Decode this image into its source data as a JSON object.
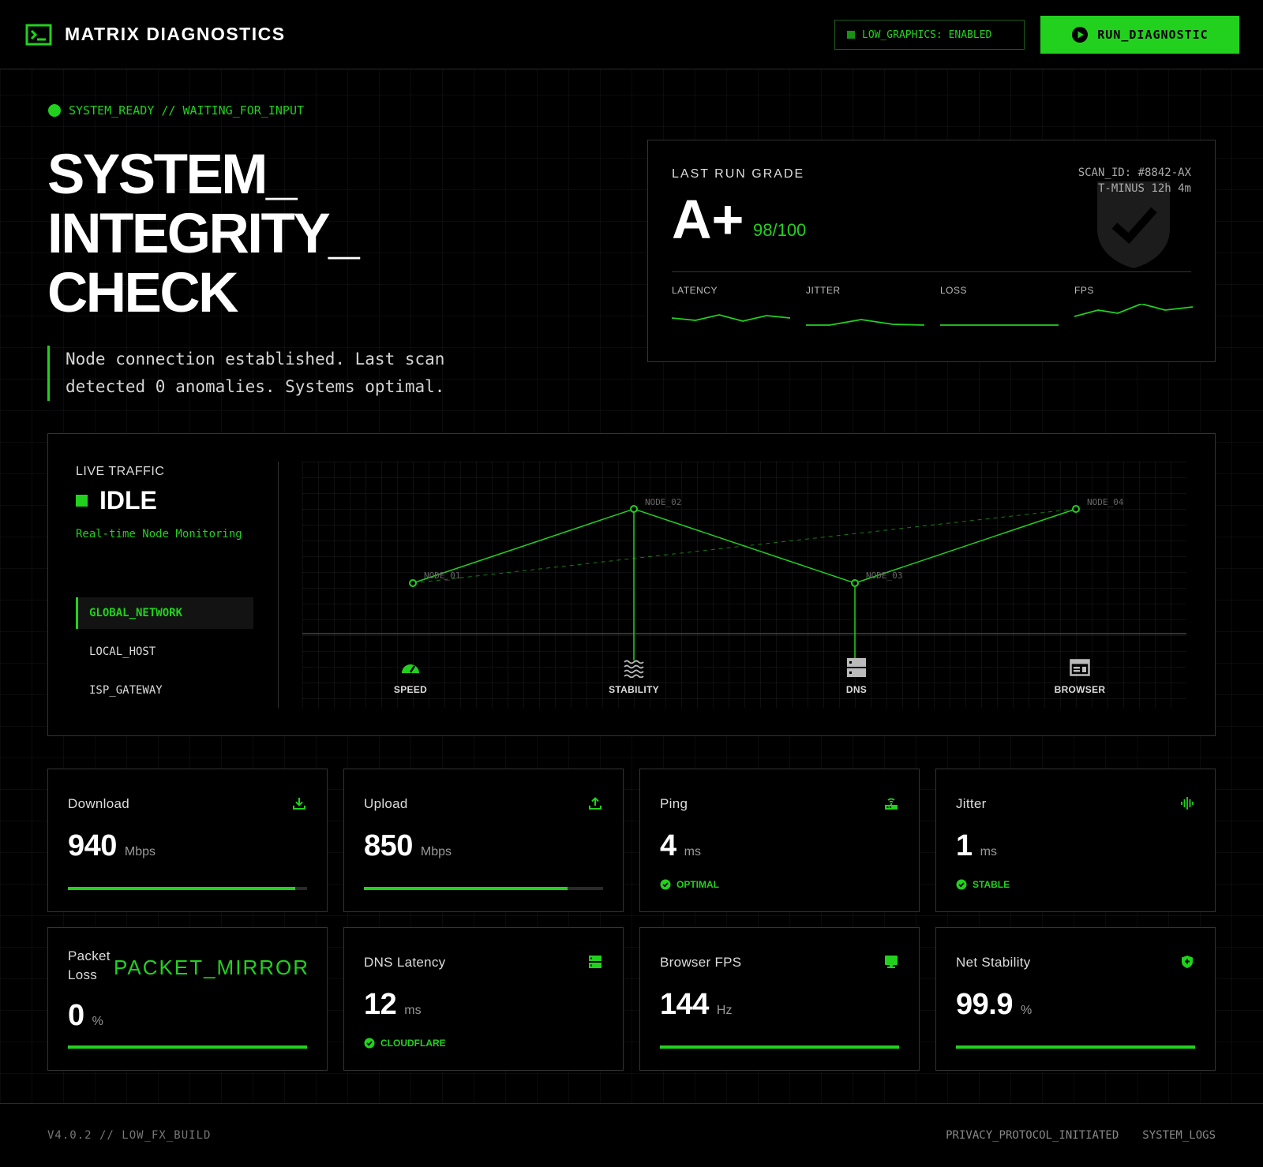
{
  "header": {
    "brand": "MATRIX DIAGNOSTICS",
    "low_graphics_label": "LOW_GRAPHICS: ENABLED",
    "run_button_label": "RUN_DIAGNOSTIC"
  },
  "hero": {
    "status": "SYSTEM_READY // WAITING_FOR_INPUT",
    "title_lines": [
      "SYSTEM_",
      "INTEGRITY_",
      "CHECK"
    ],
    "description": "Node connection established. Last scan detected 0 anomalies. Systems optimal."
  },
  "grade": {
    "label": "LAST RUN GRADE",
    "value": "A+",
    "score": "98/100",
    "scan_id": "SCAN_ID: #8842-AX",
    "t_minus": "T-MINUS 12h 4m",
    "metrics": [
      {
        "label": "LATENCY"
      },
      {
        "label": "JITTER"
      },
      {
        "label": "LOSS"
      },
      {
        "label": "FPS"
      }
    ]
  },
  "traffic": {
    "label": "LIVE TRAFFIC",
    "state": "IDLE",
    "subtitle": "Real-time Node Monitoring",
    "options": [
      {
        "label": "GLOBAL_NETWORK",
        "active": true
      },
      {
        "label": "LOCAL_HOST",
        "active": false
      },
      {
        "label": "ISP_GATEWAY",
        "active": false
      }
    ],
    "nodes": [
      "NODE_01",
      "NODE_02",
      "NODE_03",
      "NODE_04"
    ],
    "categories": [
      {
        "label": "SPEED",
        "icon": "speedometer-icon"
      },
      {
        "label": "STABILITY",
        "icon": "waves-icon"
      },
      {
        "label": "DNS",
        "icon": "server-icon"
      },
      {
        "label": "BROWSER",
        "icon": "browser-window-icon"
      }
    ]
  },
  "cards": [
    {
      "title": "Download",
      "value": "940",
      "unit": "Mbps",
      "progress": 0.95,
      "icon": "download-icon"
    },
    {
      "title": "Upload",
      "value": "850",
      "unit": "Mbps",
      "progress": 0.85,
      "icon": "upload-icon"
    },
    {
      "title": "Ping",
      "value": "4",
      "unit": "ms",
      "badge": "OPTIMAL",
      "icon": "router-icon"
    },
    {
      "title": "Jitter",
      "value": "1",
      "unit": "ms",
      "badge": "STABLE",
      "icon": "soundwave-icon"
    },
    {
      "title": "Packet Loss",
      "value": "0",
      "unit": "%",
      "progress": 1.0,
      "overlay": "PACKET_MIRROR"
    },
    {
      "title": "DNS Latency",
      "value": "12",
      "unit": "ms",
      "badge": "CLOUDFLARE",
      "icon": "dns-server-icon"
    },
    {
      "title": "Browser FPS",
      "value": "144",
      "unit": "Hz",
      "progress": 1.0,
      "icon": "monitor-icon"
    },
    {
      "title": "Net Stability",
      "value": "99.9",
      "unit": "%",
      "progress": 0.999,
      "icon": "shield-plus-icon"
    }
  ],
  "footer": {
    "version": "V4.0.2 // LOW_FX_BUILD",
    "links": [
      "PRIVACY_PROTOCOL_INITIATED",
      "SYSTEM_LOGS"
    ]
  },
  "colors": {
    "accent": "#22d11e",
    "background": "#000000"
  }
}
